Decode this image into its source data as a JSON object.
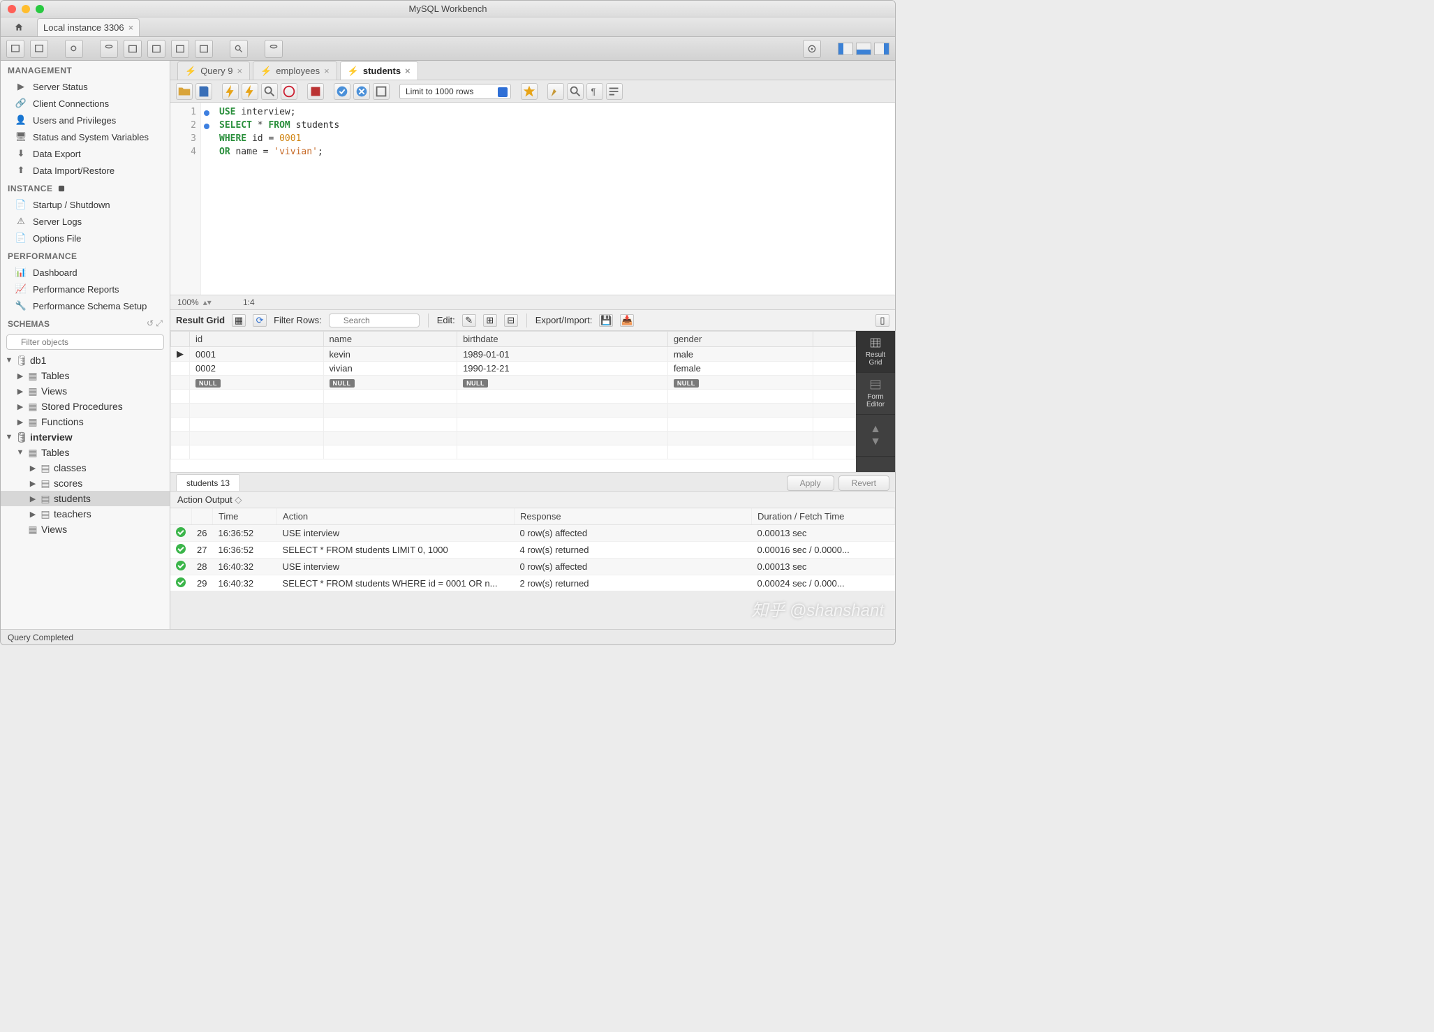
{
  "window": {
    "title": "MySQL Workbench"
  },
  "connection_tab": {
    "label": "Local instance 3306"
  },
  "navigator": {
    "management_hdr": "MANAGEMENT",
    "management": [
      "Server Status",
      "Client Connections",
      "Users and Privileges",
      "Status and System Variables",
      "Data Export",
      "Data Import/Restore"
    ],
    "instance_hdr": "INSTANCE",
    "instance": [
      "Startup / Shutdown",
      "Server Logs",
      "Options File"
    ],
    "performance_hdr": "PERFORMANCE",
    "performance": [
      "Dashboard",
      "Performance Reports",
      "Performance Schema Setup"
    ],
    "schemas_hdr": "SCHEMAS",
    "filter_placeholder": "Filter objects",
    "tree": {
      "db1": {
        "name": "db1",
        "children": [
          "Tables",
          "Views",
          "Stored Procedures",
          "Functions"
        ]
      },
      "interview": {
        "name": "interview",
        "tables_label": "Tables",
        "tables": [
          "classes",
          "scores",
          "students",
          "teachers"
        ],
        "views_label": "Views"
      }
    }
  },
  "editor": {
    "tabs": [
      {
        "label": "Query 9",
        "active": false
      },
      {
        "label": "employees",
        "active": false
      },
      {
        "label": "students",
        "active": true
      }
    ],
    "limit_label": "Limit to 1000 rows",
    "code_lines": [
      {
        "n": 1,
        "mark": true,
        "html": "<span class='kw'>USE</span> interview;"
      },
      {
        "n": 2,
        "mark": true,
        "html": "<span class='kw'>SELECT</span> * <span class='kw'>FROM</span> students"
      },
      {
        "n": 3,
        "mark": false,
        "html": "<span class='kw'>WHERE</span> id = <span class='num'>0001</span>"
      },
      {
        "n": 4,
        "mark": false,
        "html": "<span class='kw'>OR</span> name = <span class='str'>'vivian'</span>;"
      }
    ],
    "zoom": "100%",
    "cursor": "1:4"
  },
  "result": {
    "bar": {
      "label": "Result Grid",
      "filter_label": "Filter Rows:",
      "search_placeholder": "Search",
      "edit_label": "Edit:",
      "export_label": "Export/Import:"
    },
    "columns": [
      "id",
      "name",
      "birthdate",
      "gender"
    ],
    "rows": [
      [
        "0001",
        "kevin",
        "1989-01-01",
        "male"
      ],
      [
        "0002",
        "vivian",
        "1990-12-21",
        "female"
      ]
    ],
    "null_row": true,
    "tab_name": "students 13",
    "apply_label": "Apply",
    "revert_label": "Revert",
    "dock": {
      "grid": "Result\nGrid",
      "form": "Form\nEditor"
    }
  },
  "action_output": {
    "header": "Action Output",
    "columns": [
      "",
      "",
      "Time",
      "Action",
      "Response",
      "Duration / Fetch Time"
    ],
    "rows": [
      {
        "n": "26",
        "time": "16:36:52",
        "action": "USE interview",
        "response": "0 row(s) affected",
        "duration": "0.00013 sec"
      },
      {
        "n": "27",
        "time": "16:36:52",
        "action": "SELECT * FROM students LIMIT 0, 1000",
        "response": "4 row(s) returned",
        "duration": "0.00016 sec / 0.0000..."
      },
      {
        "n": "28",
        "time": "16:40:32",
        "action": "USE interview",
        "response": "0 row(s) affected",
        "duration": "0.00013 sec"
      },
      {
        "n": "29",
        "time": "16:40:32",
        "action": "SELECT * FROM students WHERE id = 0001  OR n...",
        "response": "2 row(s) returned",
        "duration": "0.00024 sec / 0.000..."
      }
    ]
  },
  "statusbar": {
    "text": "Query Completed"
  },
  "watermark": "知乎 @shanshant"
}
